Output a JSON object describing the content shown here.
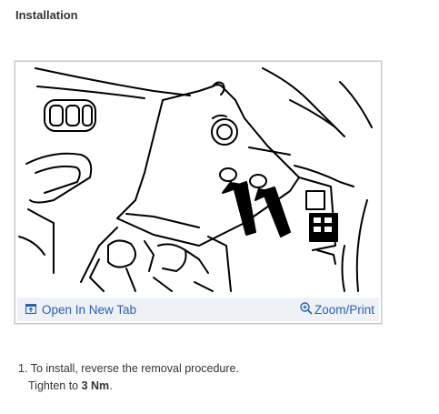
{
  "section": {
    "title": "Installation"
  },
  "figure": {
    "open_in_new_tab_label": "Open In New Tab",
    "zoom_print_label": "Zoom/Print",
    "icons": {
      "open_tab": "open-in-new-tab-icon",
      "zoom": "zoom-in-icon"
    }
  },
  "steps": [
    {
      "number": "1.",
      "text": "To install, reverse the removal procedure.",
      "detail_prefix": "Tighten to ",
      "detail_value": "3 Nm",
      "detail_suffix": "."
    }
  ],
  "colors": {
    "link": "#2a5fad",
    "toolbar_bg": "#eef1f6",
    "text": "#333333"
  }
}
